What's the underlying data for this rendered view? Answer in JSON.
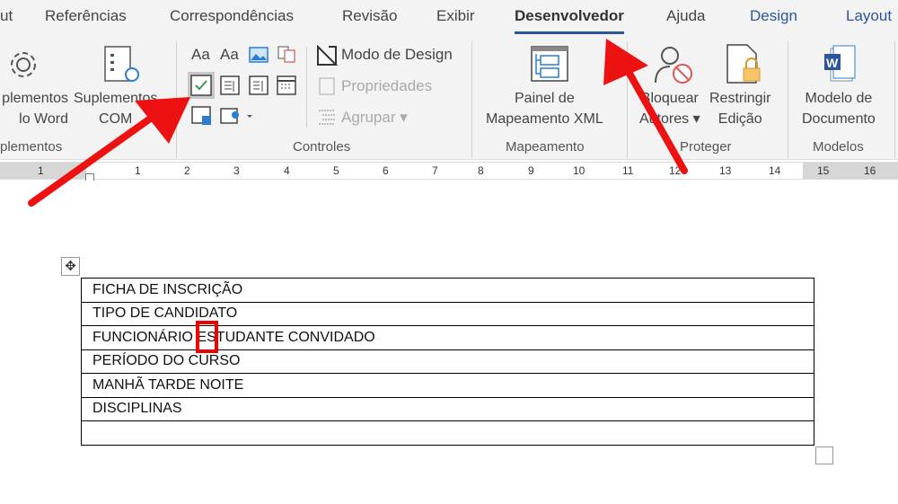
{
  "tabs": [
    "ut",
    "Referências",
    "Correspondências",
    "Revisão",
    "Exibir",
    "Desenvolvedor",
    "Ajuda",
    "Design",
    "Layout"
  ],
  "active_tab": "Desenvolvedor",
  "ribbon": {
    "addins": {
      "word_addins": "plementos\nlo Word",
      "com_addins": "Suplementos\nCOM",
      "group": "plementos"
    },
    "controls": {
      "design_mode": "Modo de Design",
      "properties": "Propriedades",
      "group_btn": "Agrupar",
      "group": "Controles"
    },
    "mapping": {
      "xml_pane": "Painel de\nMapeamento XML",
      "group": "Mapeamento"
    },
    "protect": {
      "block_authors": "Bloquear\nAutores",
      "restrict": "Restringir\nEdição",
      "group": "Proteger"
    },
    "templates": {
      "doc_template": "Modelo de\nDocumento",
      "group": "Modelos"
    }
  },
  "ruler": [
    "1",
    "1",
    "2",
    "3",
    "4",
    "5",
    "6",
    "7",
    "8",
    "9",
    "10",
    "11",
    "12",
    "13",
    "14",
    "15",
    "16"
  ],
  "table": [
    "FICHA DE INSCRIÇÃO",
    "TIPO DE CANDIDATO",
    "FUNCIONÁRIO ESTUDANTE CONVIDADO",
    "PERÍODO DO CURSO",
    "MANHÃ TARDE NOITE",
    "DISCIPLINAS",
    ""
  ],
  "colors": {
    "accent": "#2b579a",
    "arrow": "#ee1111"
  }
}
